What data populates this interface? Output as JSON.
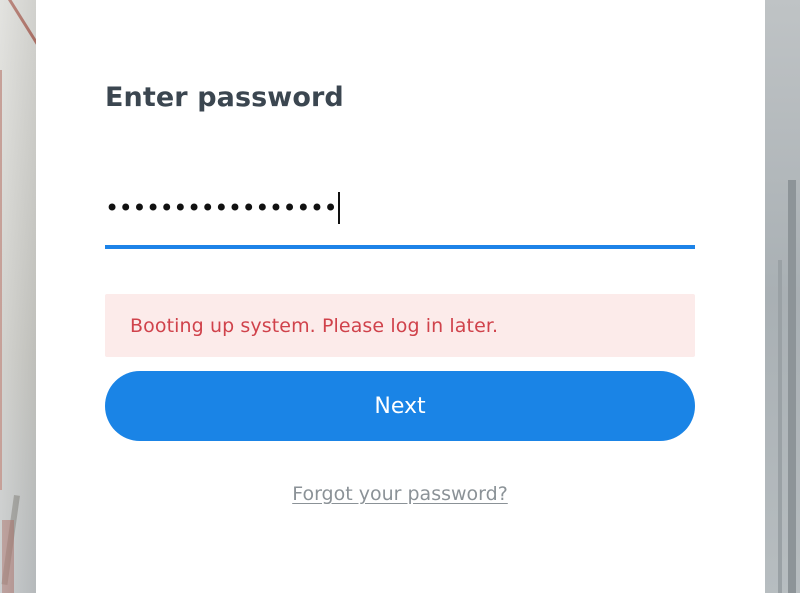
{
  "dialog": {
    "title": "Enter password",
    "password": {
      "masked_value": "•••••••••••••••••",
      "placeholder": ""
    },
    "error_message": "Booting up system. Please log in later.",
    "next_label": "Next",
    "forgot_link": "Forgot your password?"
  },
  "colors": {
    "accent": "#1a84e6",
    "error_text": "#d0424b",
    "error_bg": "#fcebea",
    "title": "#3b4650",
    "link": "#8b9297"
  }
}
